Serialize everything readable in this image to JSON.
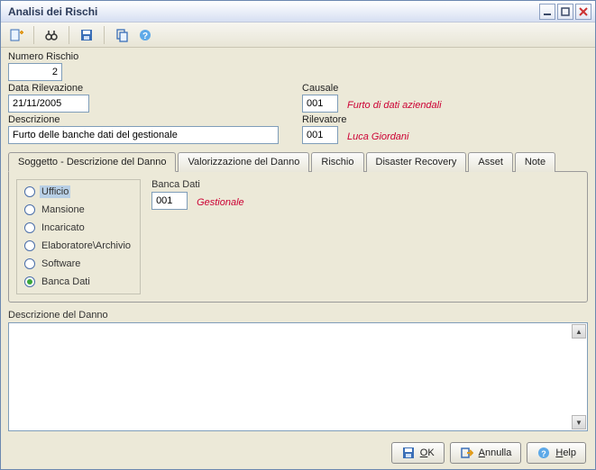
{
  "window": {
    "title": "Analisi dei Rischi"
  },
  "toolbar": {
    "icons": [
      "new",
      "find",
      "save",
      "copy",
      "help"
    ]
  },
  "fields": {
    "numero_rischio_label": "Numero Rischio",
    "numero_rischio_value": "2",
    "data_rilevazione_label": "Data Rilevazione",
    "data_rilevazione_value": "21/11/2005",
    "causale_label": "Causale",
    "causale_value": "001",
    "causale_note": "Furto di dati aziendali",
    "descrizione_label": "Descrizione",
    "descrizione_value": "Furto delle banche dati del gestionale",
    "rilevatore_label": "Rilevatore",
    "rilevatore_value": "001",
    "rilevatore_note": "Luca Giordani"
  },
  "tabs": [
    {
      "id": "soggetto",
      "label": "Soggetto - Descrizione del Danno",
      "active": true
    },
    {
      "id": "valorizzazione",
      "label": "Valorizzazione del Danno",
      "active": false
    },
    {
      "id": "rischio",
      "label": "Rischio",
      "active": false
    },
    {
      "id": "disaster",
      "label": "Disaster Recovery",
      "active": false
    },
    {
      "id": "asset",
      "label": "Asset",
      "active": false
    },
    {
      "id": "note",
      "label": "Note",
      "active": false
    }
  ],
  "radio_options": [
    {
      "id": "ufficio",
      "label": "Ufficio",
      "selected": false,
      "highlight": true
    },
    {
      "id": "mansione",
      "label": "Mansione",
      "selected": false,
      "highlight": false
    },
    {
      "id": "incaricato",
      "label": "Incaricato",
      "selected": false,
      "highlight": false
    },
    {
      "id": "elaboratore",
      "label": "Elaboratore\\Archivio",
      "selected": false,
      "highlight": false
    },
    {
      "id": "software",
      "label": "Software",
      "selected": false,
      "highlight": false
    },
    {
      "id": "bancadati",
      "label": "Banca Dati",
      "selected": true,
      "highlight": false
    }
  ],
  "banca_dati": {
    "label": "Banca Dati",
    "value": "001",
    "note": "Gestionale"
  },
  "danno": {
    "label": "Descrizione del Danno",
    "value": ""
  },
  "footer": {
    "ok_label": "OK",
    "annulla_label": "Annulla",
    "help_label": "Help"
  }
}
